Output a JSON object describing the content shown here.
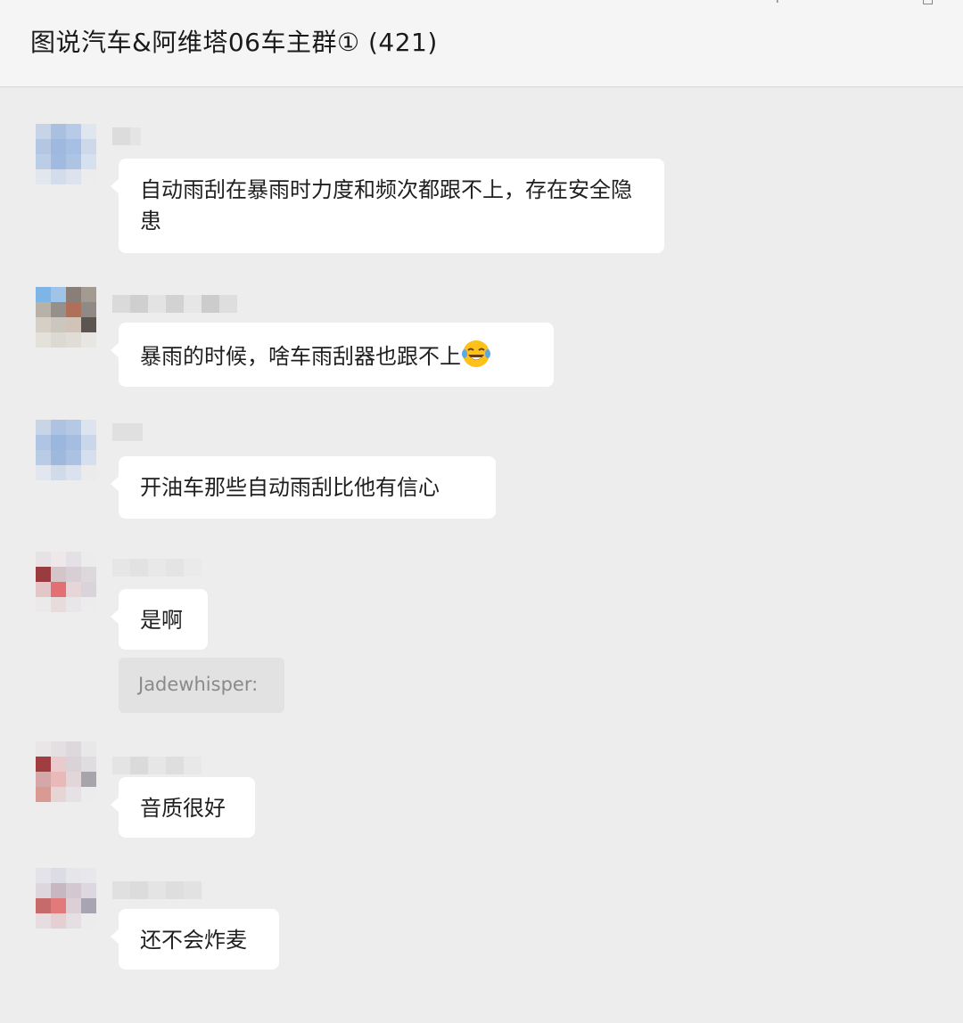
{
  "header": {
    "title": "图说汽车&阿维塔06车主群① (421)"
  },
  "messages": [
    {
      "text": "自动雨刮在暴雨时力度和频次都跟不上，存在安全隐患"
    },
    {
      "text": "暴雨的时候，啥车雨刮器也跟不上",
      "emoji": "laugh-cry-emoji"
    },
    {
      "text": "开油车那些自动雨刮比他有信心"
    },
    {
      "text": "是啊",
      "quote": "Jadewhisper:"
    },
    {
      "text": "音质很好"
    },
    {
      "text": "还不会炸麦"
    }
  ],
  "colors": {
    "background": "#ededed",
    "header_background": "#f5f5f5",
    "bubble": "#ffffff",
    "quote_background": "#e2e2e2"
  }
}
